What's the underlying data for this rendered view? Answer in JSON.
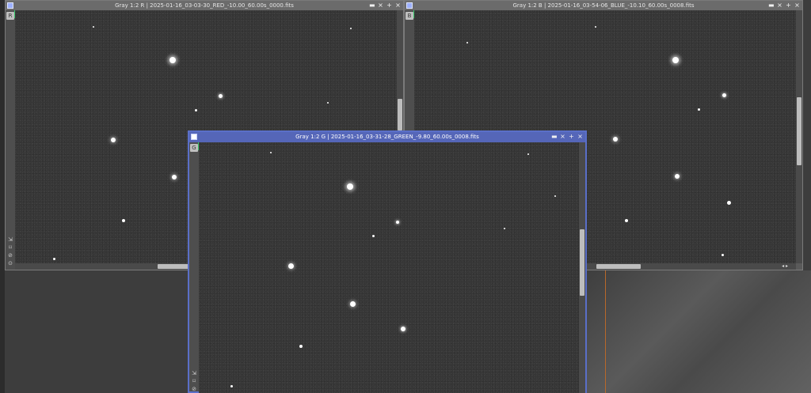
{
  "windows": {
    "red": {
      "title": "Gray 1:2 R | 2025-01-16_03-03-30_RED_-10.00_60.00s_0000.fits",
      "badge": "R"
    },
    "blue": {
      "title": "Gray 1:2 B | 2025-01-16_03-54-06_BLUE_-10.10_60.00s_0008.fits",
      "badge": "B"
    },
    "green": {
      "title": "Gray 1:2 G | 2025-01-16_03-31-28_GREEN_-9.80_60.00s_0008.fits",
      "badge": "G"
    }
  },
  "controls": {
    "shade": "▬",
    "iconize": "×",
    "maximize": "+",
    "close": "×"
  },
  "icons": {
    "system": "window-menu-icon",
    "tools": [
      "fit-view-icon",
      "pin-icon",
      "link-icon",
      "lock-icon"
    ]
  },
  "colors": {
    "active_title": "#5566b8",
    "inactive_title": "#6b6b6b",
    "image_bg": "#363636",
    "accent_line": "#b8682a"
  }
}
